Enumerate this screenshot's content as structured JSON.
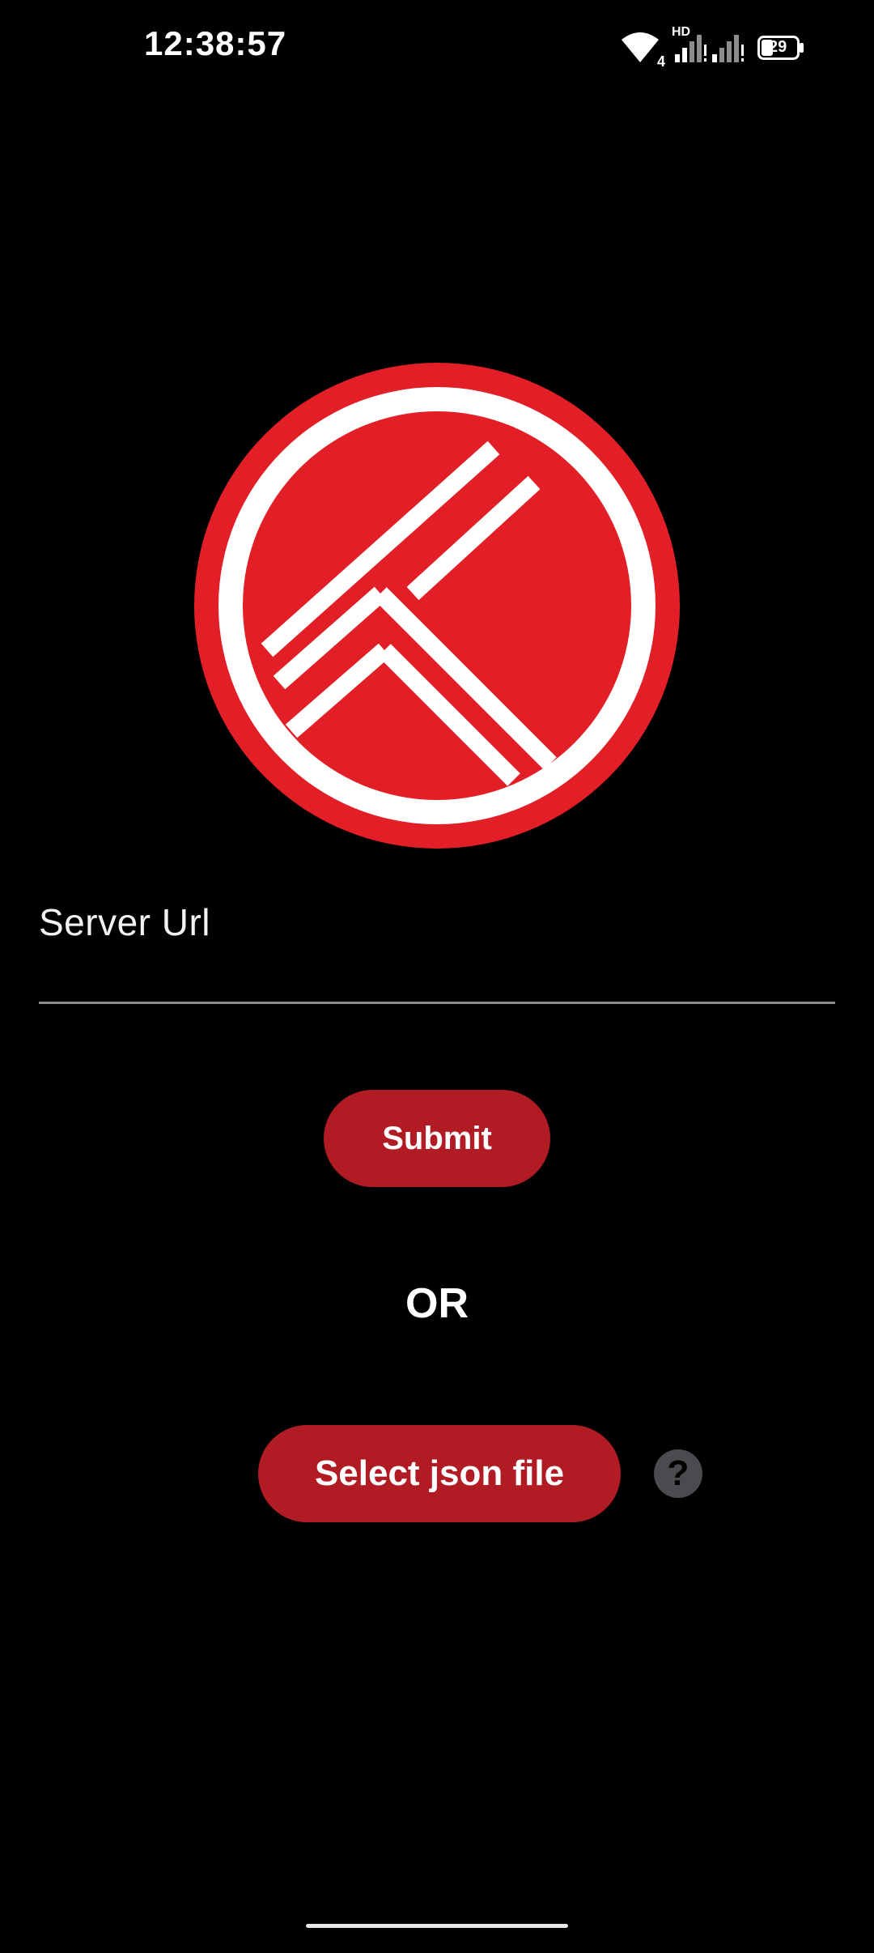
{
  "status_bar": {
    "time": "12:38:57",
    "wifi_icon": "wifi-icon",
    "wifi_badge": "4",
    "hd_label": "HD",
    "signal_icon": "signal-icon",
    "battery_icon": "battery-icon",
    "battery_level": "29"
  },
  "logo": {
    "icon": "app-logo-icon",
    "colors": {
      "red": "#e21f26",
      "white": "#ffffff"
    }
  },
  "form": {
    "server_url_label": "Server Url",
    "submit_label": "Submit",
    "or_label": "OR",
    "select_json_label": "Select json file",
    "help_icon": "help-icon",
    "help_glyph": "?"
  },
  "colors": {
    "background": "#000000",
    "accent": "#b01b24",
    "help_bg": "#4b4b4f",
    "underline": "#8a8a8a"
  }
}
